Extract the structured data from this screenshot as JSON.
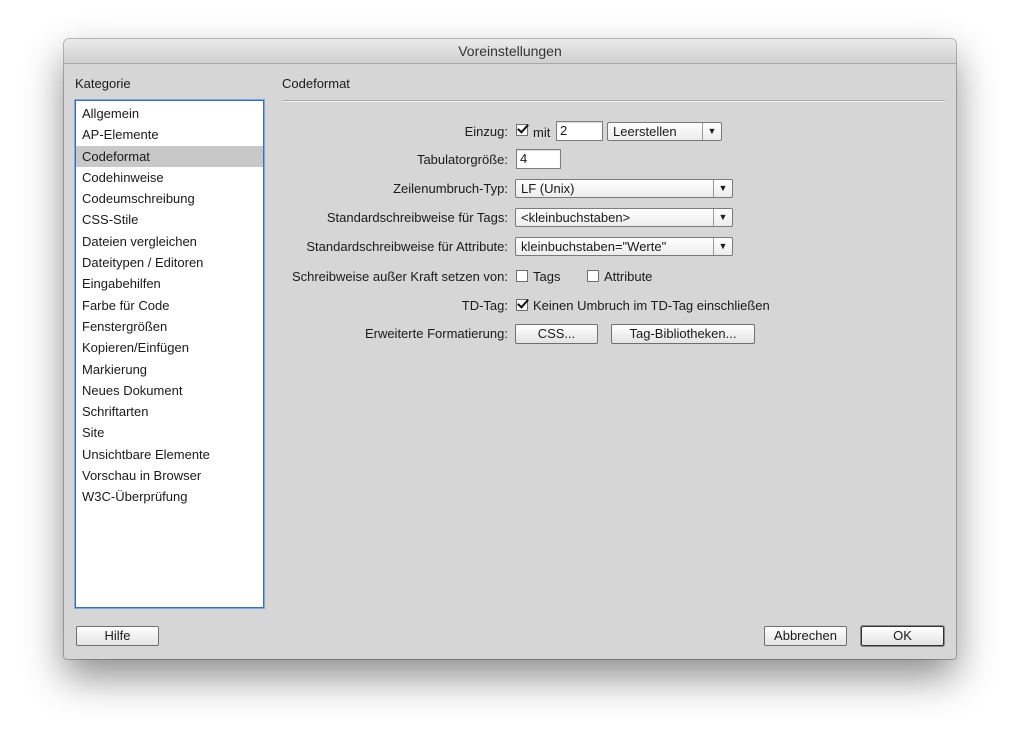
{
  "window": {
    "title": "Voreinstellungen"
  },
  "category": {
    "label": "Kategorie",
    "selected_index": 2,
    "items": [
      "Allgemein",
      "AP-Elemente",
      "Codeformat",
      "Codehinweise",
      "Codeumschreibung",
      "CSS-Stile",
      "Dateien vergleichen",
      "Dateitypen / Editoren",
      "Eingabehilfen",
      "Farbe für Code",
      "Fenstergrößen",
      "Kopieren/Einfügen",
      "Markierung",
      "Neues Dokument",
      "Schriftarten",
      "Site",
      "Unsichtbare Elemente",
      "Vorschau in Browser",
      "W3C-Überprüfung"
    ]
  },
  "panel": {
    "title": "Codeformat",
    "indent": {
      "label": "Einzug:",
      "checked": true,
      "with_label": "mit",
      "value": "2",
      "unit": "Leerstellen"
    },
    "tabsize": {
      "label": "Tabulatorgröße:",
      "value": "4"
    },
    "linebreak": {
      "label": "Zeilenumbruch-Typ:",
      "value": "LF (Unix)"
    },
    "tag_case": {
      "label": "Standardschreibweise für Tags:",
      "value": "<kleinbuchstaben>"
    },
    "attr_case": {
      "label": "Standardschreibweise für Attribute:",
      "value": "kleinbuchstaben=\"Werte\""
    },
    "override": {
      "label": "Schreibweise außer Kraft setzen von:",
      "tags_label": "Tags",
      "tags_checked": false,
      "attributes_label": "Attribute",
      "attributes_checked": false
    },
    "td_tag": {
      "label": "TD-Tag:",
      "checked": true,
      "text": "Keinen Umbruch im TD-Tag einschließen"
    },
    "advanced": {
      "label": "Erweiterte Formatierung:",
      "css_button": "CSS...",
      "tag_library_button": "Tag-Bibliotheken..."
    }
  },
  "footer": {
    "help": "Hilfe",
    "cancel": "Abbrechen",
    "ok": "OK"
  },
  "colors": {
    "dialog_bg": "#d6d6d6",
    "list_border": "#3a70b8",
    "selection": "#c8c8c8"
  }
}
